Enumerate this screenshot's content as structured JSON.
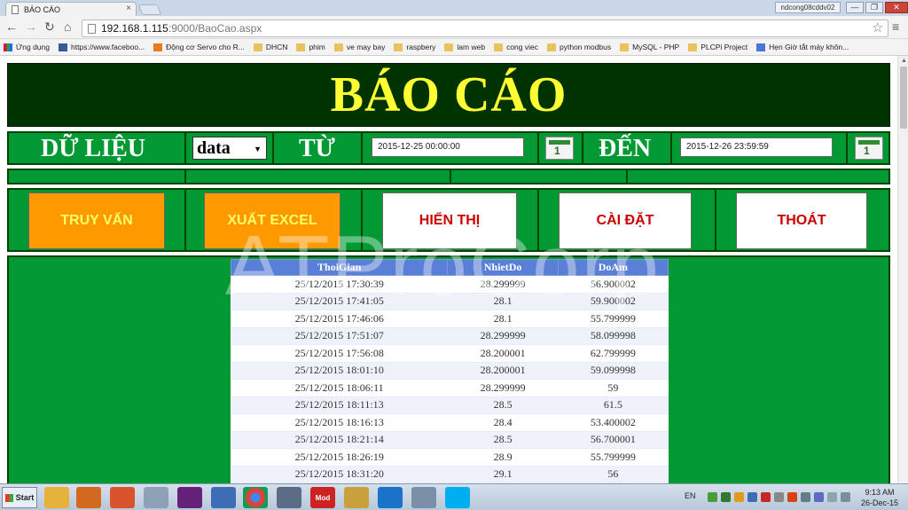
{
  "browser": {
    "tab_title": "BÁO CÁO",
    "tab_close": "×",
    "user_label": "ndcong08cddv02",
    "window_buttons": [
      "—",
      "❐",
      "✕"
    ],
    "nav": {
      "back": "←",
      "forward": "→",
      "reload": "↻",
      "home": "⌂"
    },
    "url_host": "192.168.1.115",
    "url_path": ":9000/BaoCao.aspx",
    "star": "☆",
    "menu": "≡",
    "bookmarks": [
      {
        "label": "Ứng dụng",
        "icon": "apps-icon"
      },
      {
        "label": "https://www.faceboo...",
        "icon": "facebook-icon"
      },
      {
        "label": "Động cơ Servo cho R...",
        "icon": "servo-icon"
      },
      {
        "label": "DHCN",
        "icon": "folder-icon"
      },
      {
        "label": "phim",
        "icon": "folder-icon"
      },
      {
        "label": "ve may bay",
        "icon": "folder-icon"
      },
      {
        "label": "raspbery",
        "icon": "folder-icon"
      },
      {
        "label": "lam web",
        "icon": "folder-icon"
      },
      {
        "label": "cong viec",
        "icon": "folder-icon"
      },
      {
        "label": "python modbus",
        "icon": "folder-icon"
      },
      {
        "label": "MySQL - PHP",
        "icon": "folder-icon"
      },
      {
        "label": "PLCPi Project",
        "icon": "folder-icon"
      },
      {
        "label": "Hẹn Giờ tắt máy khôn...",
        "icon": "google-icon"
      }
    ]
  },
  "page": {
    "title": "BÁO CÁO",
    "filter": {
      "data_label": "DỮ LIỆU",
      "data_select": "data",
      "from_label": "TỪ",
      "from_value": "2015-12-25 00:00:00",
      "to_label": "ĐẾN",
      "to_value": "2015-12-26 23:59:59",
      "calendar_num": "1"
    },
    "actions": {
      "query": "TRUY VẤN",
      "export": "XUẤT EXCEL",
      "show": "HIỂN THỊ",
      "settings": "CÀI ĐẶT",
      "exit": "THOÁT"
    },
    "watermark": "ATProCorp",
    "table": {
      "columns": [
        "ThoiGian",
        "NhietDo",
        "DoAm"
      ],
      "rows": [
        [
          "25/12/2015 17:30:39",
          "28.299999",
          "56.900002"
        ],
        [
          "25/12/2015 17:41:05",
          "28.1",
          "59.900002"
        ],
        [
          "25/12/2015 17:46:06",
          "28.1",
          "55.799999"
        ],
        [
          "25/12/2015 17:51:07",
          "28.299999",
          "58.099998"
        ],
        [
          "25/12/2015 17:56:08",
          "28.200001",
          "62.799999"
        ],
        [
          "25/12/2015 18:01:10",
          "28.200001",
          "59.099998"
        ],
        [
          "25/12/2015 18:06:11",
          "28.299999",
          "59"
        ],
        [
          "25/12/2015 18:11:13",
          "28.5",
          "61.5"
        ],
        [
          "25/12/2015 18:16:13",
          "28.4",
          "53.400002"
        ],
        [
          "25/12/2015 18:21:14",
          "28.5",
          "56.700001"
        ],
        [
          "25/12/2015 18:26:19",
          "28.9",
          "55.799999"
        ],
        [
          "25/12/2015 18:31:20",
          "29.1",
          "56"
        ]
      ]
    }
  },
  "taskbar": {
    "start": "Start",
    "lang": "EN",
    "time": "9:13 AM",
    "date": "26-Dec-15",
    "mod_label": "Mod"
  }
}
